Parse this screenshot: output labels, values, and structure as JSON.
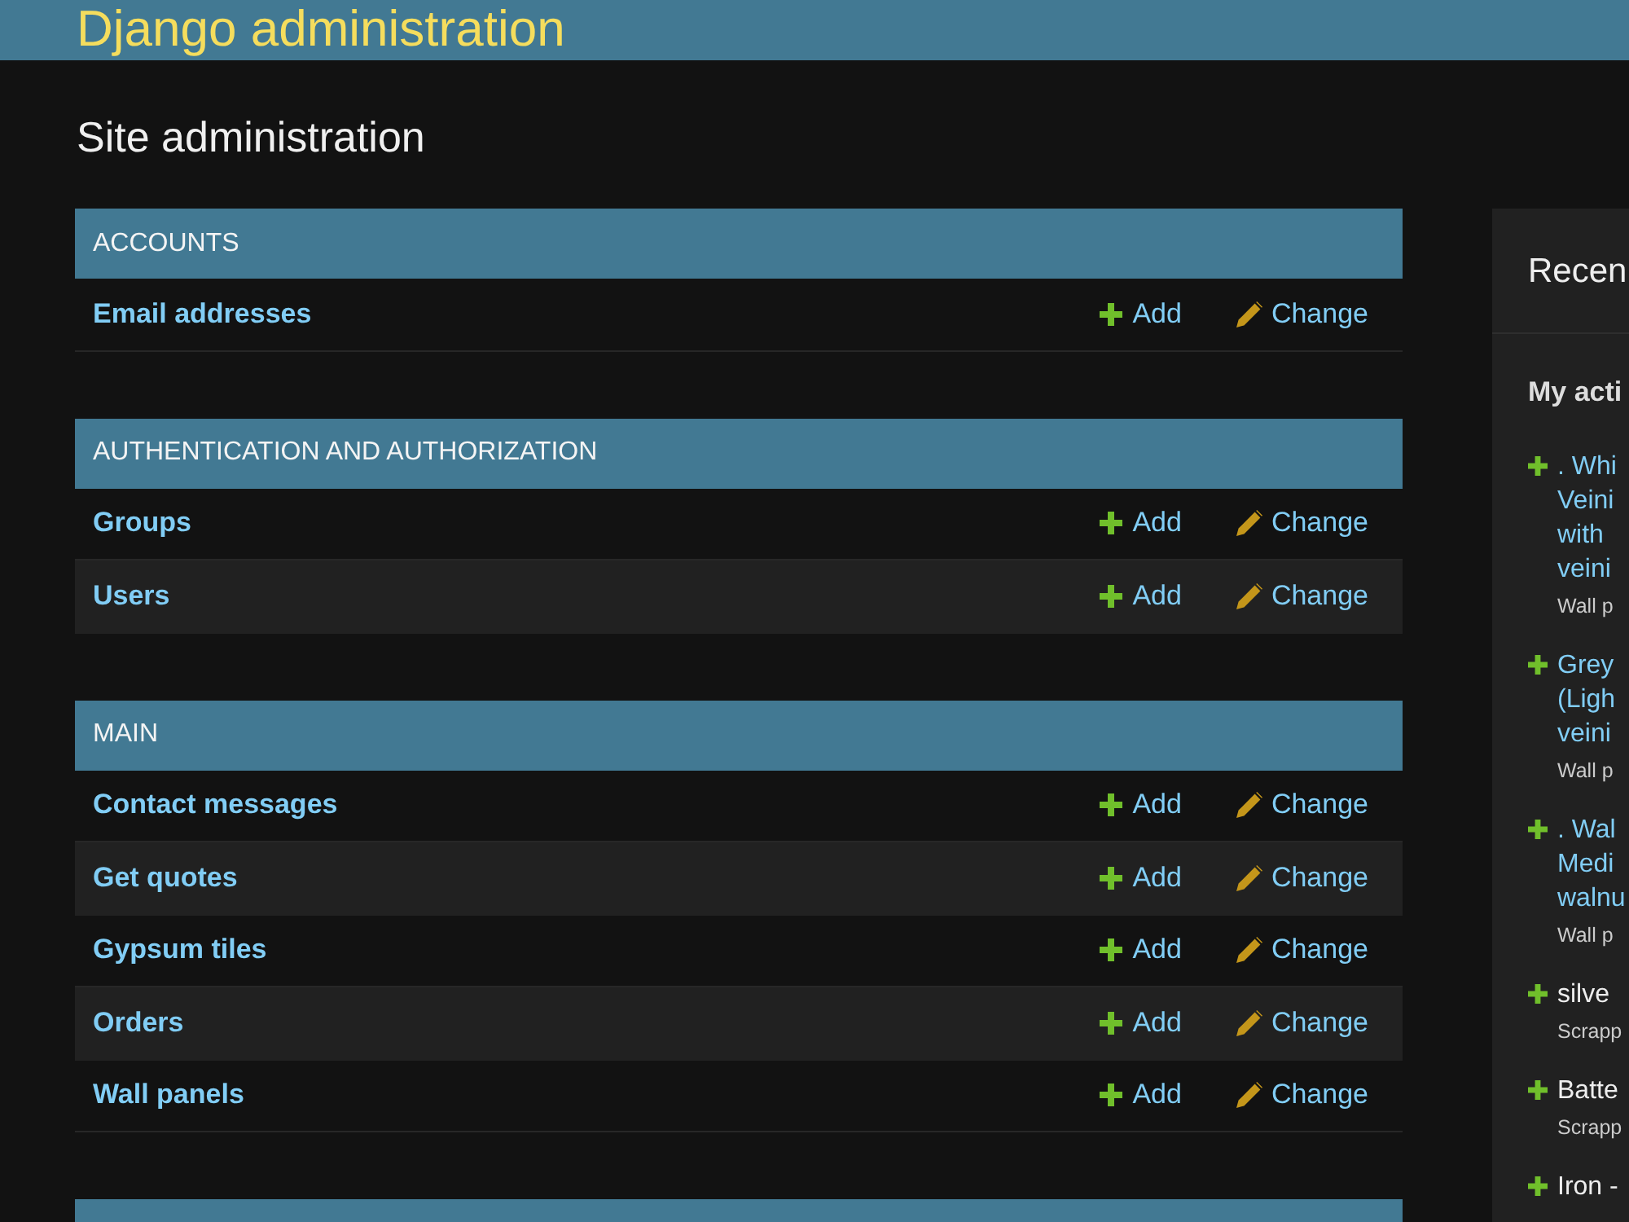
{
  "header": {
    "title": "Django administration"
  },
  "page_title": "Site administration",
  "modules": [
    {
      "caption": "ACCOUNTS",
      "rows": [
        {
          "name": "Email addresses",
          "add": "Add",
          "change": "Change"
        }
      ]
    },
    {
      "caption": "AUTHENTICATION AND AUTHORIZATION",
      "rows": [
        {
          "name": "Groups",
          "add": "Add",
          "change": "Change"
        },
        {
          "name": "Users",
          "add": "Add",
          "change": "Change"
        }
      ]
    },
    {
      "caption": "MAIN",
      "rows": [
        {
          "name": "Contact messages",
          "add": "Add",
          "change": "Change"
        },
        {
          "name": "Get quotes",
          "add": "Add",
          "change": "Change"
        },
        {
          "name": "Gypsum tiles",
          "add": "Add",
          "change": "Change"
        },
        {
          "name": "Orders",
          "add": "Add",
          "change": "Change"
        },
        {
          "name": "Wall panels",
          "add": "Add",
          "change": "Change"
        }
      ]
    }
  ],
  "recent_actions": {
    "title": "Recen",
    "subtitle": "My acti",
    "entries": [
      {
        "kind": "addition",
        "text": ". Whi\nVeini\nwith\nveini",
        "linked": true,
        "content_type": "Wall p"
      },
      {
        "kind": "addition",
        "text": "Grey\n(Ligh\nveini",
        "linked": true,
        "content_type": "Wall p"
      },
      {
        "kind": "addition",
        "text": ". Wal\nMedi\nwalnu",
        "linked": true,
        "content_type": "Wall p"
      },
      {
        "kind": "addition",
        "text": "silve",
        "linked": false,
        "content_type": "Scrapp"
      },
      {
        "kind": "addition",
        "text": "Batte",
        "linked": false,
        "content_type": "Scrapp"
      },
      {
        "kind": "addition",
        "text": "Iron -",
        "linked": false
      }
    ]
  }
}
